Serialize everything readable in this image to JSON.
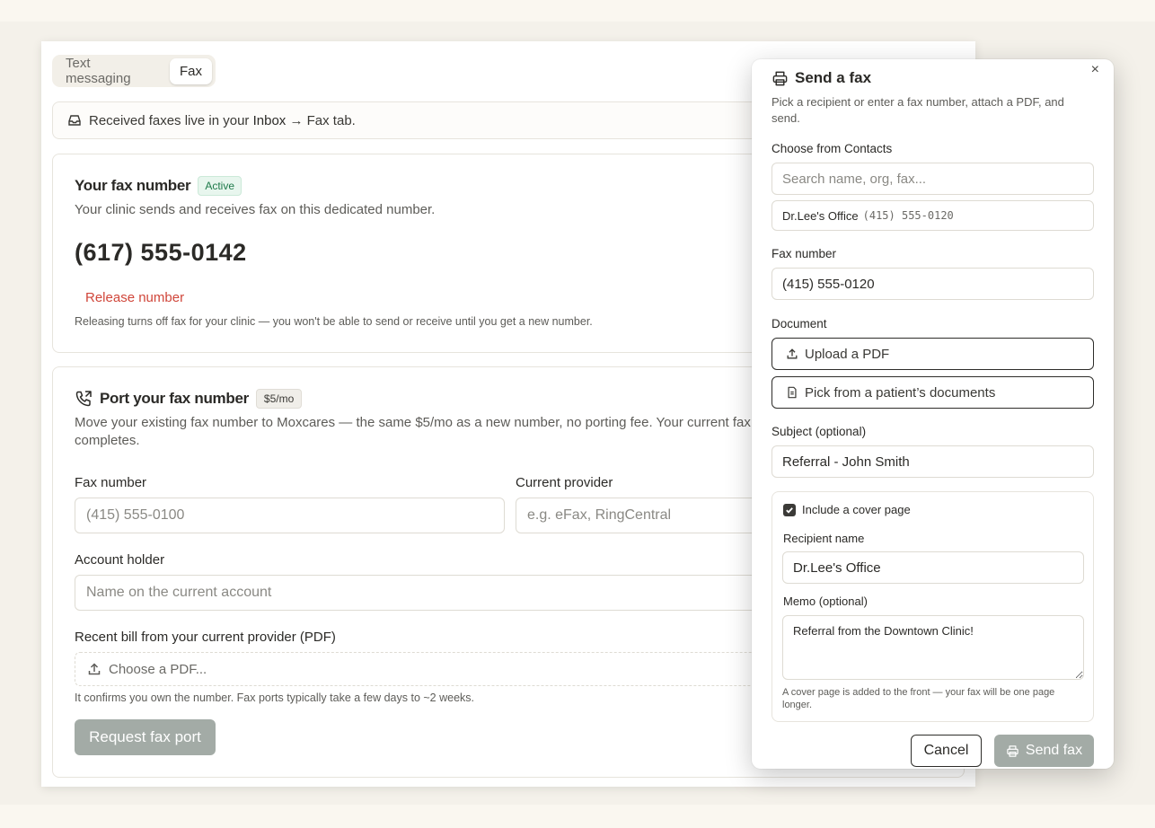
{
  "tabs": [
    {
      "label": "Text messaging",
      "active": false
    },
    {
      "label": "Fax",
      "active": true
    }
  ],
  "banner": {
    "text_before": "Received faxes live in your ",
    "inbox_link": "Inbox",
    "text_after": " → Fax tab."
  },
  "fax_number_section": {
    "title": "Your fax number",
    "status_badge": "Active",
    "description": "Your clinic sends and receives fax on this dedicated number.",
    "number": "(617) 555-0142",
    "release_label": "Release number",
    "release_note": "Releasing turns off fax for your clinic — you won't be able to send or receive until you get a new number."
  },
  "port_section": {
    "title": "Port your fax number",
    "price_badge": "$5/mo",
    "description": "Move your existing fax number to Moxcares — the same $5/mo as a new number, no porting fee. Your current fax k completes.",
    "fax_number_label": "Fax number",
    "fax_number_placeholder": "(415) 555-0100",
    "provider_label": "Current provider",
    "provider_placeholder": "e.g. eFax, RingCentral",
    "account_holder_label": "Account holder",
    "account_holder_placeholder": "Name on the current account",
    "bill_label": "Recent bill from your current provider (PDF)",
    "choose_pdf": "Choose a PDF...",
    "bill_note": "It confirms you own the number. Fax ports typically take a few days to ~2 weeks.",
    "request_button": "Request fax port"
  },
  "modal": {
    "close": "×",
    "title": "Send a fax",
    "description": "Pick a recipient or enter a fax number, attach a PDF, and send.",
    "contacts_label": "Choose from Contacts",
    "search_placeholder": "Search name, org, fax...",
    "contact": {
      "name": "Dr.Lee's Office",
      "number": "(415) 555-0120"
    },
    "fax_number_label": "Fax number",
    "fax_number_value": "(415) 555-0120",
    "document_label": "Document",
    "upload_pdf": "Upload a PDF",
    "pick_documents": "Pick from a patient’s documents",
    "subject_label": "Subject (optional)",
    "subject_value": "Referral - John Smith",
    "cover": {
      "checkbox_label": "Include a cover page",
      "checked": true,
      "recipient_label": "Recipient name",
      "recipient_value": "Dr.Lee's Office",
      "memo_label": "Memo (optional)",
      "memo_value": "Referral from the Downtown Clinic!",
      "note": "A cover page is added to the front — your fax will be one page longer."
    },
    "cancel": "Cancel",
    "send": "Send fax"
  },
  "colors": {
    "accent_danger": "#d0463a",
    "badge_active_text": "#1e7a4a",
    "disabled_button": "#a3aba6",
    "background": "#faf7f0"
  }
}
